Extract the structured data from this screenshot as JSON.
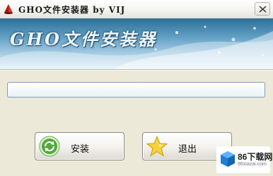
{
  "window": {
    "title": "GHO文件安装器   by VIJ",
    "app_icon": "red-cone-icon",
    "close_icon": "close-x-icon"
  },
  "banner": {
    "title": "GHO文件安装器"
  },
  "progress": {
    "value": 0
  },
  "buttons": {
    "install": {
      "label": "安装",
      "icon": "green-circular-arrows-icon"
    },
    "exit": {
      "label": "退出",
      "icon": "yellow-star-icon"
    }
  },
  "watermark": {
    "text": "86下载网",
    "sub": "86xiazai.com"
  },
  "colors": {
    "window_bg": "#ece9d8",
    "banner_top": "#2e6e95",
    "banner_bottom": "#dceef7",
    "progress_border": "#7f9db9"
  }
}
